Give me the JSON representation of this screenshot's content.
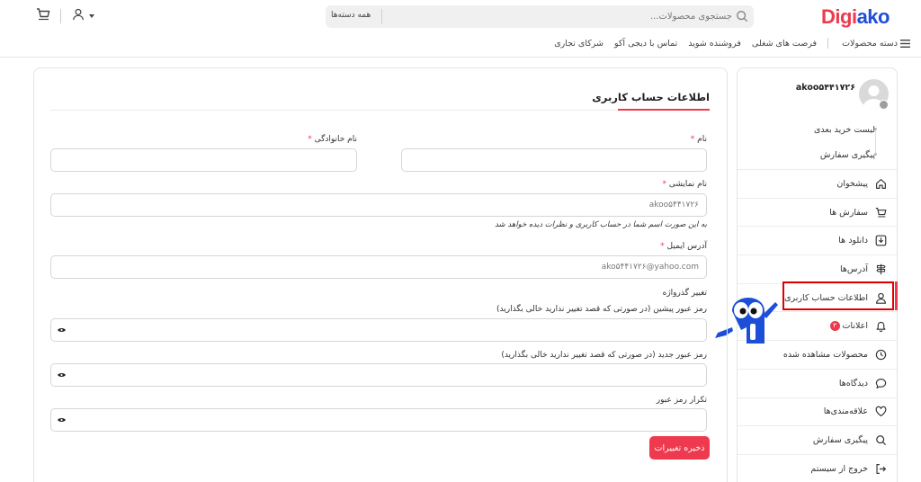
{
  "header": {
    "logo_part1": "Digi",
    "logo_part2": "ako",
    "search_placeholder": "جستجوی محصولات...",
    "category_select": "همه دسته‌ها"
  },
  "nav": {
    "categories": "دسته محصولات",
    "items": [
      "فرصت های شغلی",
      "فروشنده شوید",
      "تماس با دیجی آکو",
      "شرکای تجاری"
    ]
  },
  "sidebar": {
    "username": "akoo۵۴۴۱۷۲۶",
    "quick_links": [
      "لیست خرید بعدی",
      "پیگیری سفارش"
    ],
    "menu": [
      {
        "label": "پیشخوان",
        "icon": "home-icon"
      },
      {
        "label": "سفارش ها",
        "icon": "cart-icon"
      },
      {
        "label": "دانلود ها",
        "icon": "download-icon"
      },
      {
        "label": "آدرس‌ها",
        "icon": "signpost-icon"
      },
      {
        "label": "اطلاعات حساب کاربری",
        "icon": "user-icon"
      },
      {
        "label": "اعلانات",
        "icon": "bell-icon",
        "badge": "۳"
      },
      {
        "label": "محصولات مشاهده شده",
        "icon": "clock-icon"
      },
      {
        "label": "دیدگاه‌ها",
        "icon": "comment-icon"
      },
      {
        "label": "علاقه‌مندی‌ها",
        "icon": "heart-icon"
      },
      {
        "label": "پیگیری سفارش",
        "icon": "search-icon"
      },
      {
        "label": "خروج از سیستم",
        "icon": "logout-icon"
      }
    ]
  },
  "form": {
    "title": "اطلاعات حساب کاربری",
    "first_name_label": "نام",
    "last_name_label": "نام خانوادگی",
    "required_mark": "*",
    "first_name_value": "",
    "last_name_value": "",
    "display_name_label": "نام نمایشی",
    "display_name_value": "akoo۵۴۴۱۷۲۶",
    "display_name_hint": "به این صورت اسم شما در حساب کاربری و نظرات دیده خواهد شد",
    "email_label": "آدرس ایمیل",
    "email_value": "ako۵۴۴۱۷۲۶@yahoo.com",
    "password_section": "تغییر گذرواژه",
    "current_password_label": "رمز عبور پیشین (در صورتی که قصد تغییر ندارید خالی بگذارید)",
    "new_password_label": "رمز عبور جدید (در صورتی که قصد تغییر ندارید خالی بگذارید)",
    "confirm_password_label": "تکرار رمز عبور",
    "save_label": "ذخیره تغییرات"
  },
  "colors": {
    "brand_red": "#ef394e",
    "brand_blue": "#1d4ed8",
    "highlight": "#e00000"
  }
}
